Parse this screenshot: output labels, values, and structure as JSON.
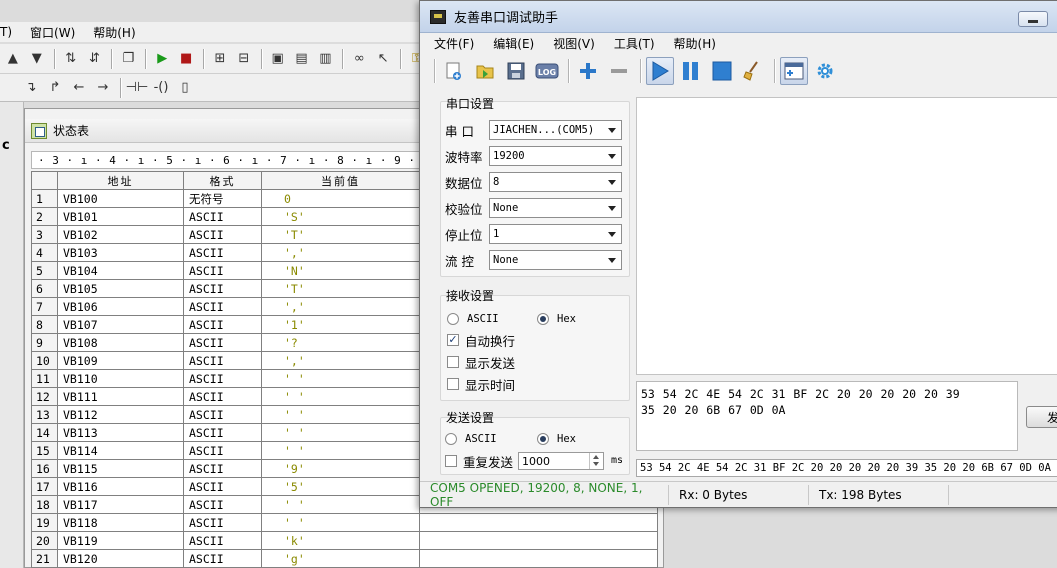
{
  "bg_app": {
    "menu": [
      "T)",
      "窗口(W)",
      "帮助(H)"
    ],
    "left_label": "c",
    "mdi_title": "状态表",
    "ruler": "· 3 · ı · 4 · ı · 5 · ı · 6 · ı · 7 · ı · 8 · ı · 9 · ı ·10 · ı ·11 · ı ·12 · ı",
    "table": {
      "headers": [
        "",
        "地址",
        "格式",
        "当前值",
        ""
      ],
      "rows": [
        {
          "n": "1",
          "addr": "VB100",
          "fmt": "无符号",
          "val": "0"
        },
        {
          "n": "2",
          "addr": "VB101",
          "fmt": "ASCII",
          "val": "'S'"
        },
        {
          "n": "3",
          "addr": "VB102",
          "fmt": "ASCII",
          "val": "'T'"
        },
        {
          "n": "4",
          "addr": "VB103",
          "fmt": "ASCII",
          "val": "','"
        },
        {
          "n": "5",
          "addr": "VB104",
          "fmt": "ASCII",
          "val": "'N'"
        },
        {
          "n": "6",
          "addr": "VB105",
          "fmt": "ASCII",
          "val": "'T'"
        },
        {
          "n": "7",
          "addr": "VB106",
          "fmt": "ASCII",
          "val": "','"
        },
        {
          "n": "8",
          "addr": "VB107",
          "fmt": "ASCII",
          "val": "'1'"
        },
        {
          "n": "9",
          "addr": "VB108",
          "fmt": "ASCII",
          "val": "'?"
        },
        {
          "n": "10",
          "addr": "VB109",
          "fmt": "ASCII",
          "val": "','"
        },
        {
          "n": "11",
          "addr": "VB110",
          "fmt": "ASCII",
          "val": "' '"
        },
        {
          "n": "12",
          "addr": "VB111",
          "fmt": "ASCII",
          "val": "' '"
        },
        {
          "n": "13",
          "addr": "VB112",
          "fmt": "ASCII",
          "val": "' '"
        },
        {
          "n": "14",
          "addr": "VB113",
          "fmt": "ASCII",
          "val": "' '"
        },
        {
          "n": "15",
          "addr": "VB114",
          "fmt": "ASCII",
          "val": "' '"
        },
        {
          "n": "16",
          "addr": "VB115",
          "fmt": "ASCII",
          "val": "'9'"
        },
        {
          "n": "17",
          "addr": "VB116",
          "fmt": "ASCII",
          "val": "'5'"
        },
        {
          "n": "18",
          "addr": "VB117",
          "fmt": "ASCII",
          "val": "' '"
        },
        {
          "n": "19",
          "addr": "VB118",
          "fmt": "ASCII",
          "val": "' '"
        },
        {
          "n": "20",
          "addr": "VB119",
          "fmt": "ASCII",
          "val": "'k'"
        },
        {
          "n": "21",
          "addr": "VB120",
          "fmt": "ASCII",
          "val": "'g'"
        }
      ]
    }
  },
  "serial": {
    "title": "友善串口调试助手",
    "menu": [
      "文件(F)",
      "编辑(E)",
      "视图(V)",
      "工具(T)",
      "帮助(H)"
    ],
    "toolbar_icons": [
      "new-icon",
      "open-icon",
      "save-icon",
      "log-icon",
      "add-icon",
      "remove-icon",
      "play-icon",
      "pause-icon",
      "stop-icon",
      "clear-broom-icon",
      "window-icon",
      "settings-gear-icon"
    ],
    "port_settings": {
      "title": "串口设置",
      "port_label": "串 口",
      "port_value": "JIACHEN...(COM5)",
      "baud_label": "波特率",
      "baud_value": "19200",
      "databits_label": "数据位",
      "databits_value": "8",
      "parity_label": "校验位",
      "parity_value": "None",
      "stopbits_label": "停止位",
      "stopbits_value": "1",
      "flow_label": "流 控",
      "flow_value": "None"
    },
    "rx_settings": {
      "title": "接收设置",
      "ascii_label": "ASCII",
      "hex_label": "Hex",
      "selected": "Hex",
      "auto_newline_label": "自动换行",
      "auto_newline_checked": true,
      "show_send_label": "显示发送",
      "show_send_checked": false,
      "show_time_label": "显示时间",
      "show_time_checked": false
    },
    "tx_settings": {
      "title": "发送设置",
      "ascii_label": "ASCII",
      "hex_label": "Hex",
      "selected": "Hex",
      "repeat_label": "重复发送",
      "repeat_checked": false,
      "interval_value": "1000",
      "interval_unit": "ms"
    },
    "tx_text": "53 54 2C 4E 54 2C 31 BF 2C 20 20 20 20 20 39\n35 20 20 6B 67 0D 0A",
    "send_button": "发",
    "history_value": "53 54 2C 4E 54 2C 31 BF 2C 20 20 20 20 20 39 35 20 20 6B 67 0D 0A",
    "status": {
      "connection": "COM5 OPENED, 19200, 8, NONE, 1, OFF",
      "rx": "Rx: 0 Bytes",
      "tx": "Tx: 198 Bytes"
    },
    "colors": {
      "status_ok": "#2a8a2a",
      "ascii_value": "#8a8a00",
      "titlebar": "#c3d3ea"
    }
  }
}
